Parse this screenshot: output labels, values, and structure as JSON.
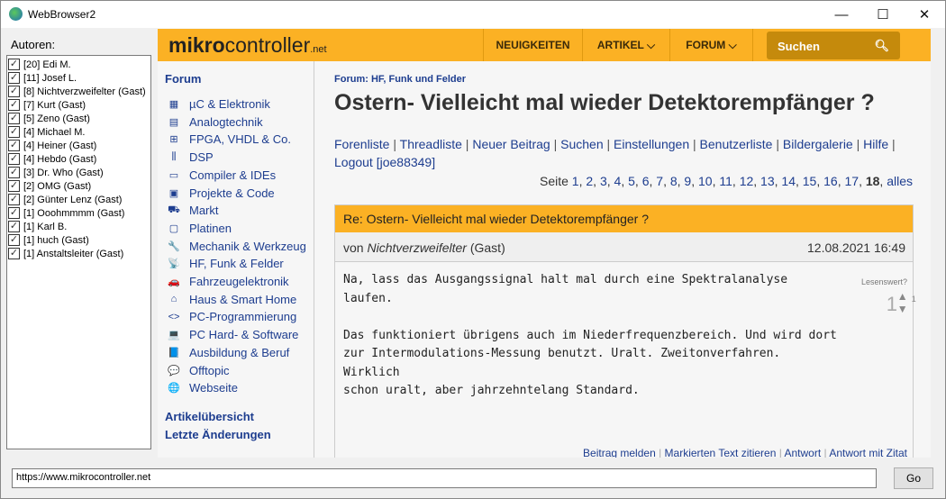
{
  "window": {
    "title": "WebBrowser2",
    "minimize": "—",
    "maximize": "☐",
    "close": "✕"
  },
  "authors": {
    "label": "Autoren:",
    "items": [
      "[20] Edi M.",
      "[11] Josef L.",
      "[8] Nichtverzweifelter (Gast)",
      "[7] Kurt (Gast)",
      "[5] Zeno (Gast)",
      "[4] Michael M.",
      "[4] Heiner (Gast)",
      "[4] Hebdo (Gast)",
      "[3] Dr. Who (Gast)",
      "[2] OMG (Gast)",
      "[2] Günter Lenz (Gast)",
      "[1] Ooohmmmm (Gast)",
      "[1] Karl B.",
      "[1] huch (Gast)",
      "[1] Anstaltsleiter (Gast)"
    ]
  },
  "site": {
    "logo_bold": "mikro",
    "logo_rest": "controller",
    "logo_tld": ".net",
    "nav": [
      "NEUIGKEITEN",
      "ARTIKEL ⌵",
      "FORUM ⌵"
    ],
    "search": "Suchen"
  },
  "sidebar": {
    "heading": "Forum",
    "items": [
      {
        "icon": "▦",
        "label": "µC & Elektronik"
      },
      {
        "icon": "▤",
        "label": "Analogtechnik"
      },
      {
        "icon": "⊞",
        "label": "FPGA, VHDL & Co."
      },
      {
        "icon": "⫼",
        "label": "DSP"
      },
      {
        "icon": "▭",
        "label": "Compiler & IDEs"
      },
      {
        "icon": "▣",
        "label": "Projekte & Code"
      },
      {
        "icon": "⛟",
        "label": "Markt"
      },
      {
        "icon": "▢",
        "label": "Platinen"
      },
      {
        "icon": "🔧",
        "label": "Mechanik & Werkzeug"
      },
      {
        "icon": "📡",
        "label": "HF, Funk & Felder"
      },
      {
        "icon": "🚗",
        "label": "Fahrzeugelektronik"
      },
      {
        "icon": "⌂",
        "label": "Haus & Smart Home"
      },
      {
        "icon": "<>",
        "label": "PC-Programmierung"
      },
      {
        "icon": "💻",
        "label": "PC Hard- & Software"
      },
      {
        "icon": "📘",
        "label": "Ausbildung & Beruf"
      },
      {
        "icon": "💬",
        "label": "Offtopic"
      },
      {
        "icon": "🌐",
        "label": "Webseite"
      }
    ],
    "bottom": [
      "Artikelübersicht",
      "Letzte Änderungen"
    ]
  },
  "main": {
    "breadcrumb": "Forum: HF, Funk und Felder",
    "title": "Ostern- Vielleicht mal wieder Detektorempfänger ?",
    "links": [
      "Forenliste",
      "Threadliste",
      "Neuer Beitrag",
      "Suchen",
      "Einstellungen",
      "Benutzerliste",
      "Bildergalerie",
      "Hilfe",
      "Logout [joe88349]"
    ],
    "pages_label": "Seite",
    "pages": [
      "1",
      "2",
      "3",
      "4",
      "5",
      "6",
      "7",
      "8",
      "9",
      "10",
      "11",
      "12",
      "13",
      "14",
      "15",
      "16",
      "17"
    ],
    "current_page": "18",
    "all": "alles",
    "post": {
      "subject": "Re: Ostern- Vielleicht mal wieder Detektorempfänger ?",
      "by": "von",
      "author": "Nichtverzweifelter",
      "guest": "(Gast)",
      "date": "12.08.2021 16:49",
      "body": "Na, lass das Ausgangssignal halt mal durch eine Spektralanalyse\nlaufen.\n\nDas funktioniert übrigens auch im Niederfrequenzbereich. Und wird dort\nzur Intermodulations-Messung benutzt. Uralt. Zweitonverfahren.\nWirklich\nschon uralt, aber jahrzehntelang Standard.",
      "rating_label": "Lesenswert?",
      "rating": "1",
      "rating_count": "1",
      "actions": [
        "Beitrag melden",
        "Markierten Text zitieren",
        "Antwort",
        "Antwort mit Zitat"
      ]
    }
  },
  "address": {
    "url": "https://www.mikrocontroller.net",
    "go": "Go"
  }
}
